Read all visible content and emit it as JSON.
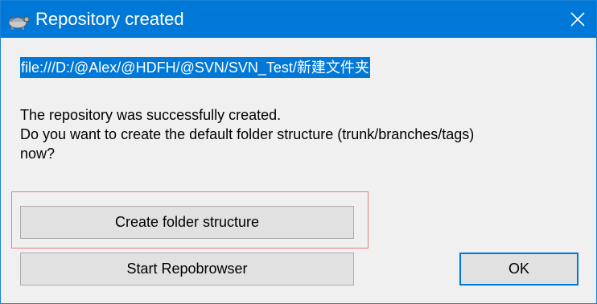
{
  "window": {
    "title": "Repository created",
    "app_icon": "tortoisesvn-icon",
    "close_icon": "close-icon"
  },
  "content": {
    "url": "file:///D:/@Alex/@HDFH/@SVN/SVN_Test/新建文件夹",
    "message_lines": [
      "The repository was successfully created.",
      "Do you want to create the default folder structure (trunk/branches/tags)",
      "now?"
    ]
  },
  "buttons": {
    "create_folder_structure": "Create folder structure",
    "start_repobrowser": "Start Repobrowser",
    "ok": "OK"
  },
  "colors": {
    "titlebar": "#0078d7",
    "selection": "#0078d7",
    "highlight_border": "#e08080",
    "button_face": "#e1e1e1"
  }
}
